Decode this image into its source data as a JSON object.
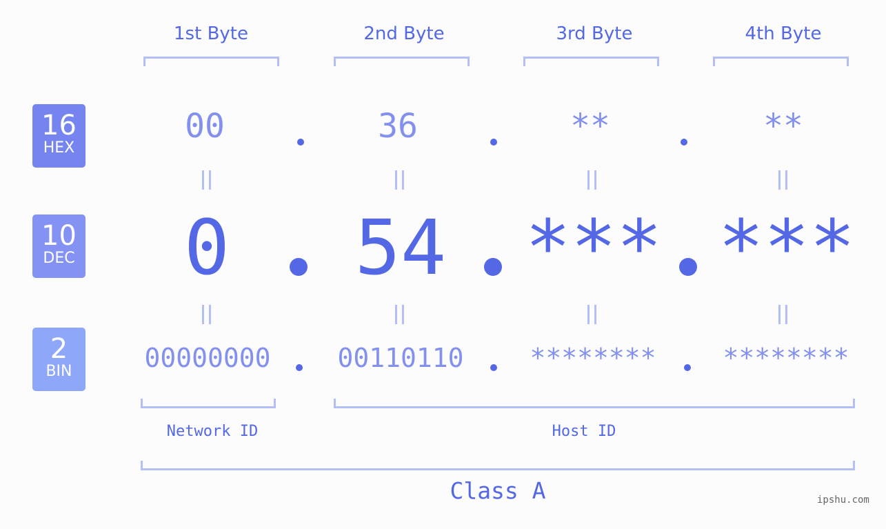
{
  "badges": [
    {
      "num": "16",
      "label": "HEX",
      "color": "#7584ee"
    },
    {
      "num": "10",
      "label": "DEC",
      "color": "#8493f3"
    },
    {
      "num": "2",
      "label": "BIN",
      "color": "#8fa7f8"
    }
  ],
  "headers": [
    "1st Byte",
    "2nd Byte",
    "3rd Byte",
    "4th Byte"
  ],
  "hex": [
    "00",
    "36",
    "**",
    "**"
  ],
  "dec": [
    "0",
    "54",
    "***",
    "***"
  ],
  "bin": [
    "00000000",
    "00110110",
    "********",
    "********"
  ],
  "labels": {
    "network_id": "Network ID",
    "host_id": "Host ID",
    "class": "Class A"
  },
  "watermark": "ipshu.com",
  "colors": {
    "accent": "#5468e6",
    "light": "#8390ee",
    "bracket": "#b5bff7"
  }
}
